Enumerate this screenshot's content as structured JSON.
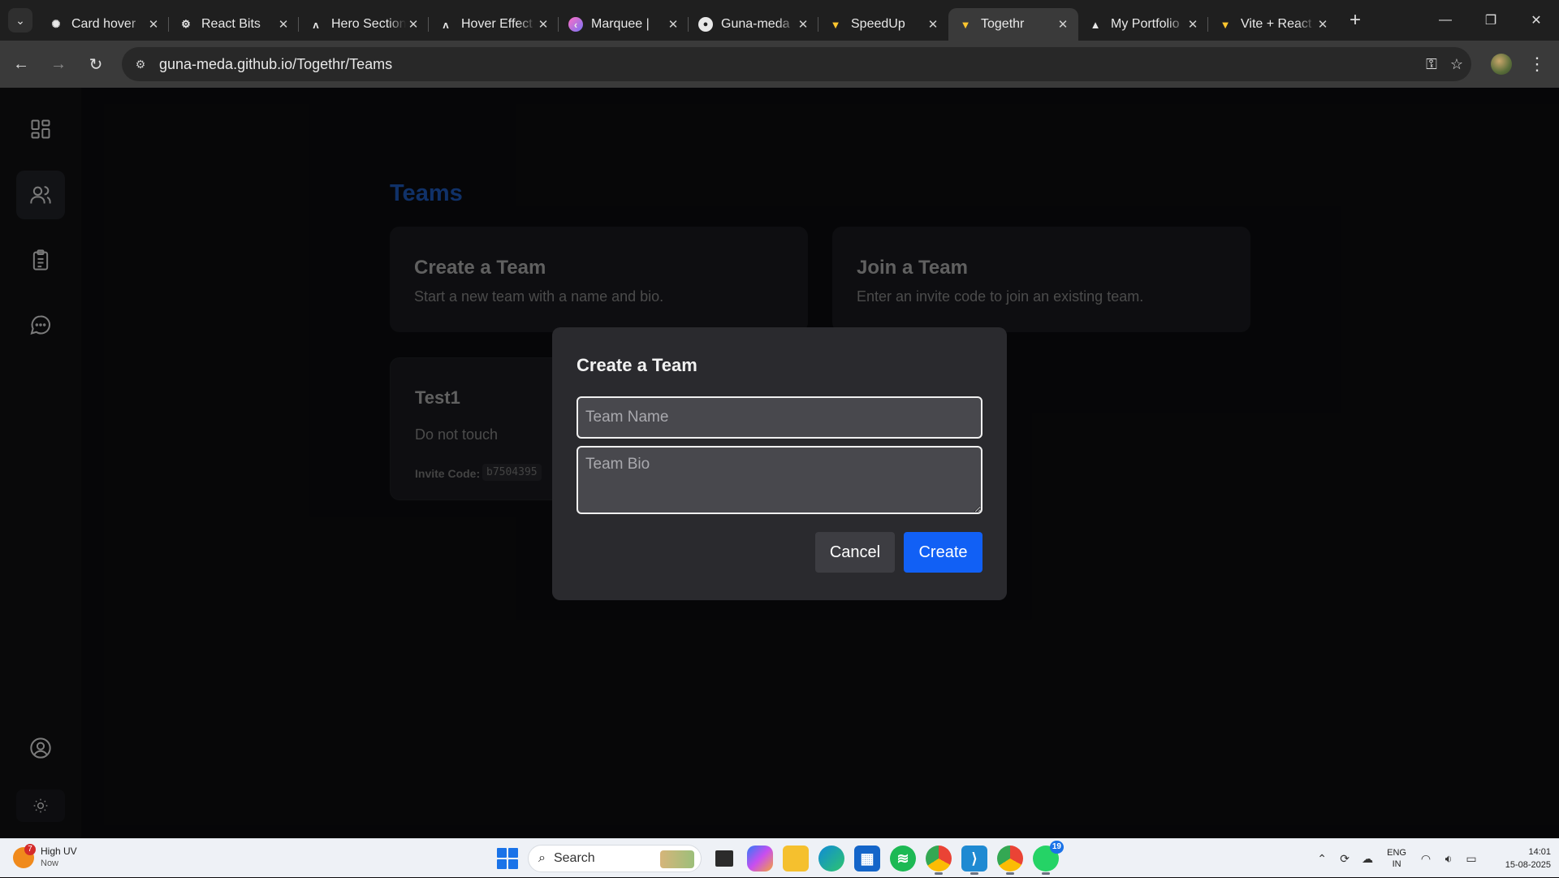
{
  "browser": {
    "tabs": [
      {
        "title": "Card hover",
        "icon": "openai-icon",
        "active": false
      },
      {
        "title": "React Bits",
        "icon": "reactbits-icon",
        "active": false
      },
      {
        "title": "Hero Section",
        "icon": "aceternity-icon",
        "active": false
      },
      {
        "title": "Hover Effect",
        "icon": "aceternity-icon",
        "active": false
      },
      {
        "title": "Marquee |",
        "icon": "magicui-icon",
        "active": false
      },
      {
        "title": "Guna-meda",
        "icon": "github-icon",
        "active": false
      },
      {
        "title": "SpeedUp",
        "icon": "vite-icon",
        "active": false
      },
      {
        "title": "Togethr",
        "icon": "vite-icon",
        "active": true
      },
      {
        "title": "My Portfolio",
        "icon": "vercel-icon",
        "active": false
      },
      {
        "title": "Vite + React",
        "icon": "vite-icon",
        "active": false
      }
    ],
    "url": "guna-meda.github.io/Togethr/Teams"
  },
  "app": {
    "page_title": "Teams",
    "cards": {
      "create": {
        "title": "Create a Team",
        "desc": "Start a new team with a name and bio."
      },
      "join": {
        "title": "Join a Team",
        "desc": "Enter an invite code to join an existing team."
      }
    },
    "team": {
      "name": "Test1",
      "bio": "Do not touch",
      "invite_label": "Invite Code:",
      "invite_code": "b7504395"
    },
    "modal": {
      "title": "Create a Team",
      "name_placeholder": "Team Name",
      "bio_placeholder": "Team Bio",
      "cancel_label": "Cancel",
      "create_label": "Create"
    }
  },
  "taskbar": {
    "weather_badge": "7",
    "weather_title": "High UV",
    "weather_sub": "Now",
    "search_label": "Search",
    "whatsapp_badge": "19",
    "lang_top": "ENG",
    "lang_bottom": "IN",
    "time": "14:01",
    "date": "15-08-2025"
  },
  "colors": {
    "accent": "#1160f5",
    "title_blue": "#1b4fa8"
  }
}
